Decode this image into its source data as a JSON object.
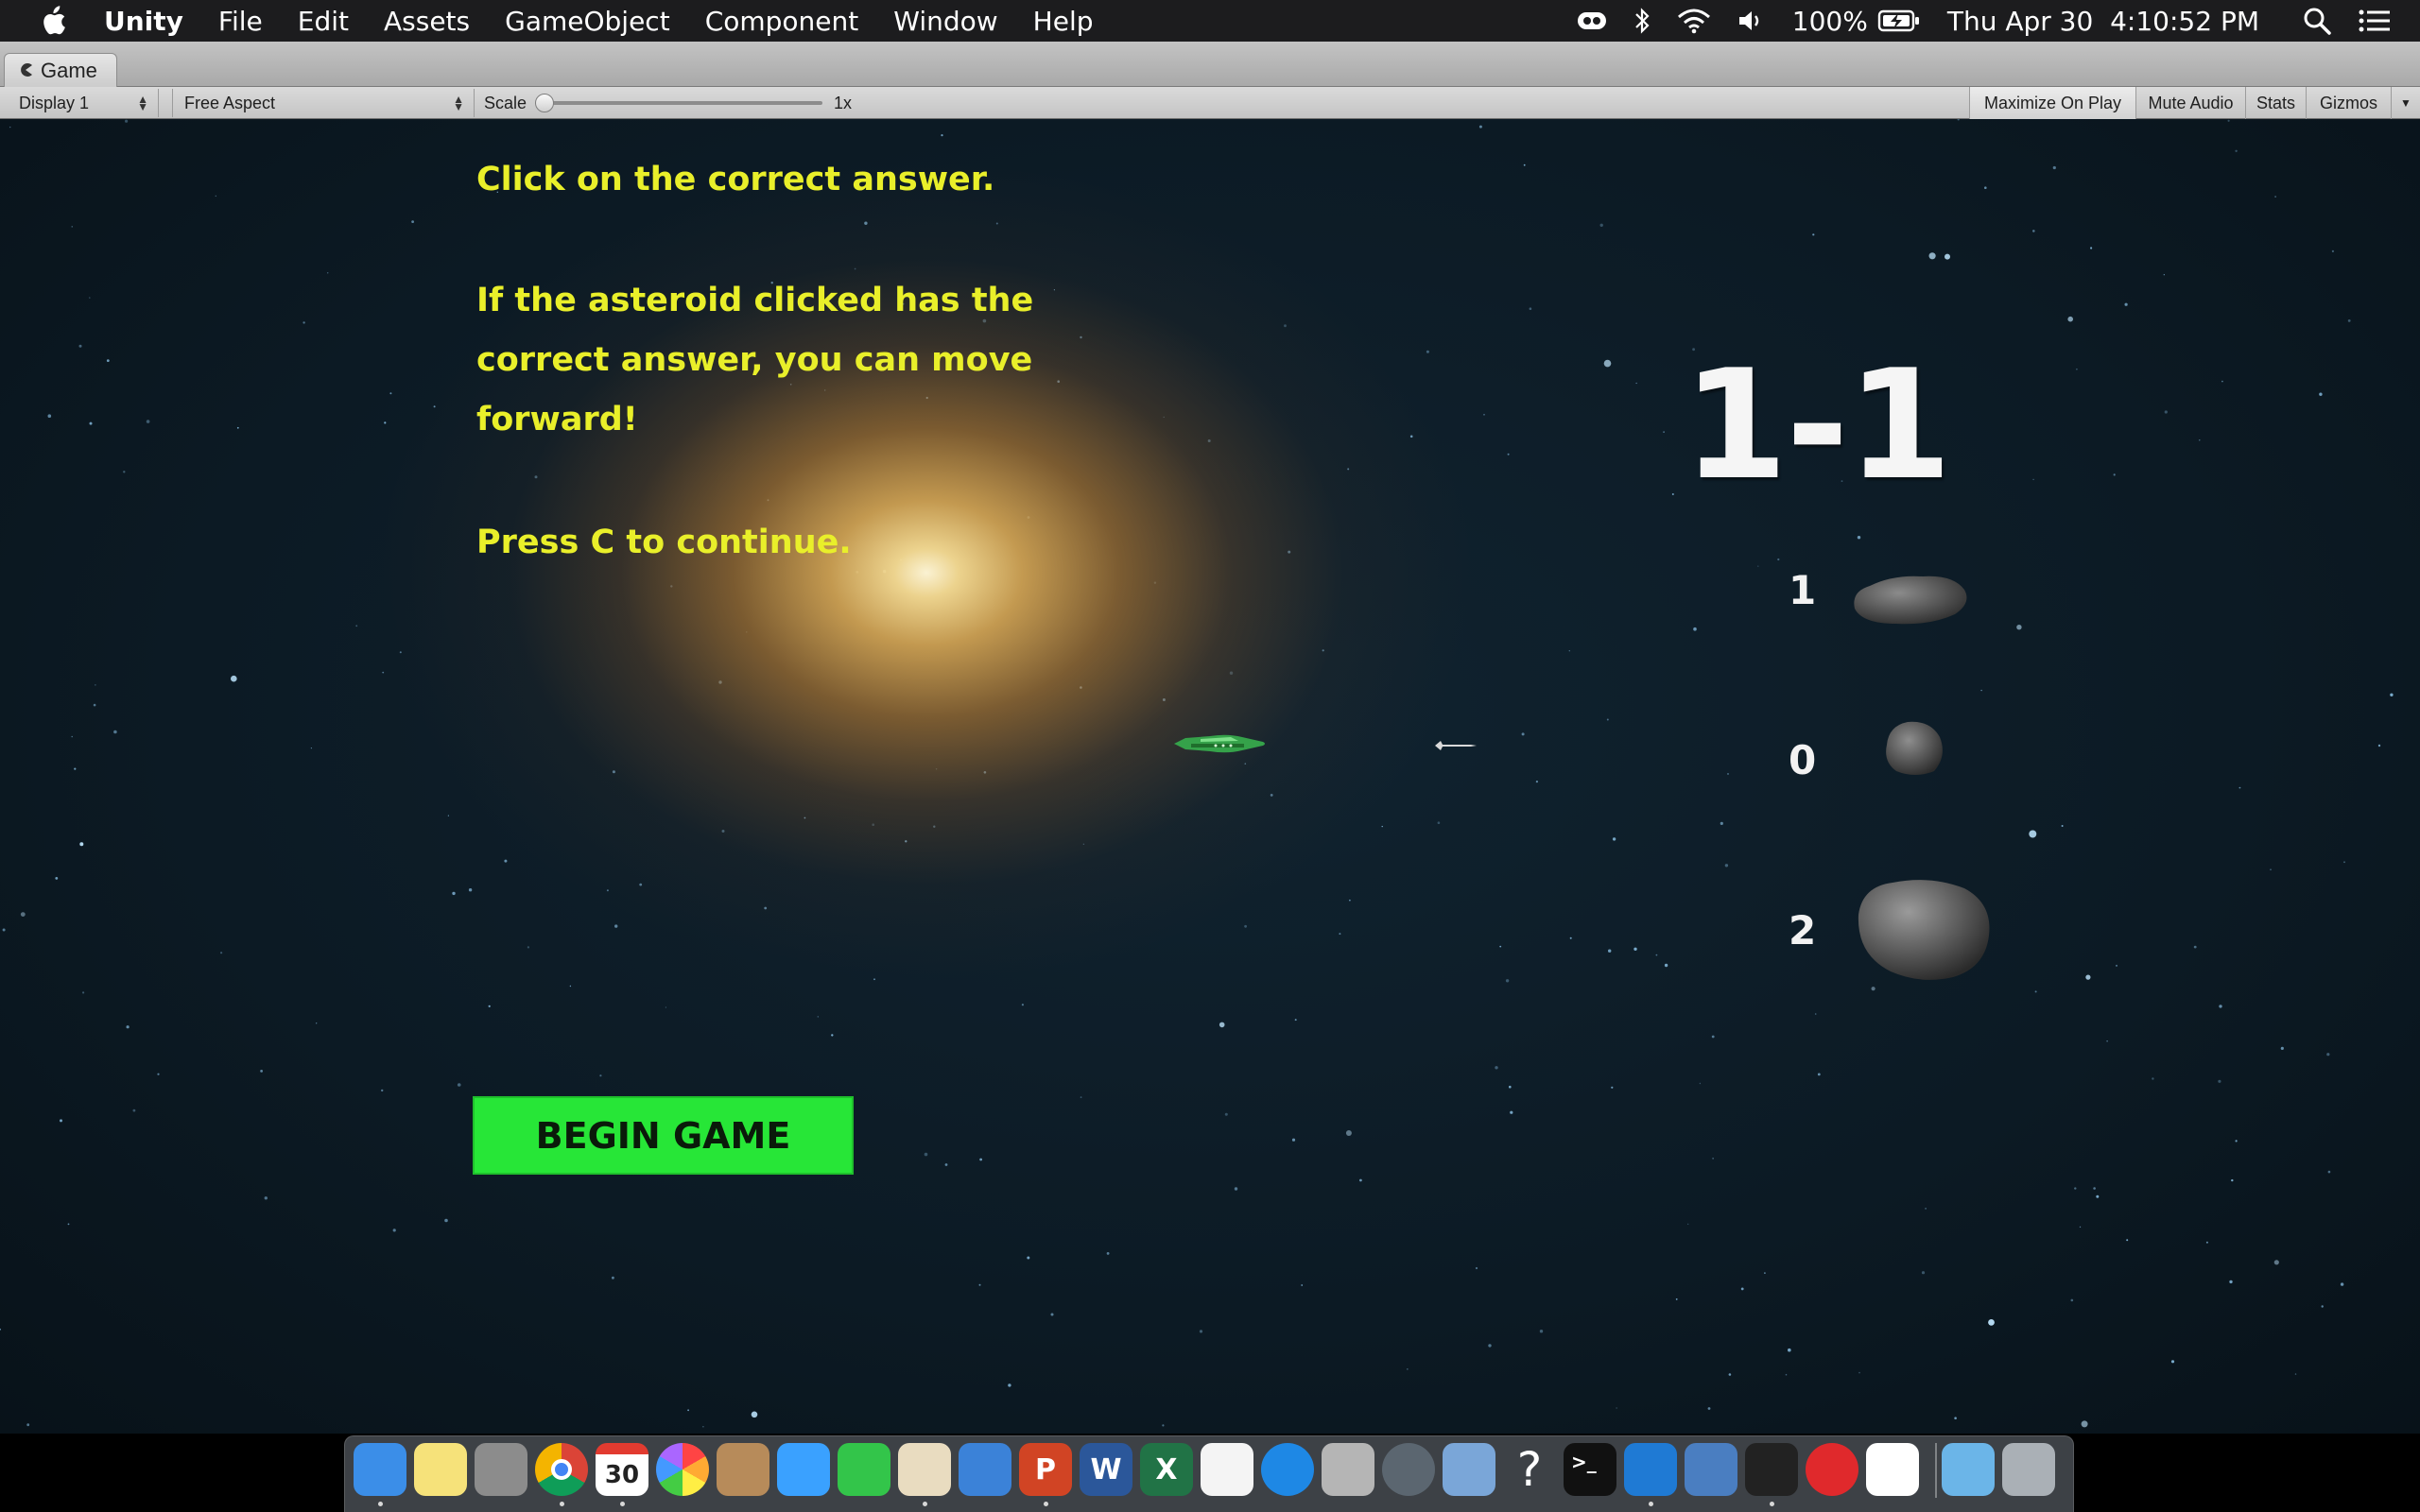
{
  "menubar": {
    "apple_icon": "apple-logo-icon",
    "app_name": "Unity",
    "menus": [
      "File",
      "Edit",
      "Assets",
      "GameObject",
      "Component",
      "Window",
      "Help"
    ],
    "battery_percent": "100%",
    "datetime": "Thu Apr 30  4:10:52 PM",
    "status_icons": [
      "creative-cloud-icon",
      "bluetooth-icon",
      "wifi-icon",
      "volume-icon",
      "battery-charging-icon",
      "spotlight-search-icon",
      "control-center-icon"
    ]
  },
  "window": {
    "tab_label": "Game",
    "display_select": "Display 1",
    "aspect_select": "Free Aspect",
    "scale_label": "Scale",
    "scale_value": "1x",
    "scale_level": 0,
    "buttons": {
      "maximize": "Maximize On Play",
      "mute": "Mute Audio",
      "stats": "Stats",
      "gizmos": "Gizmos"
    }
  },
  "game": {
    "instructions": {
      "line1": "Click on the correct answer.",
      "line2": "If the asteroid clicked has the",
      "line3": "correct answer, you can move",
      "line4": "forward!",
      "line5": "Press C to continue."
    },
    "level": "1-1",
    "answers": [
      "1",
      "0",
      "2"
    ],
    "begin_button": "BEGIN GAME"
  },
  "colors": {
    "instruction_text": "#e9ef2a",
    "begin_button": "#27e637",
    "space_bg": "#0c1a24"
  },
  "dock": {
    "apps": [
      {
        "name": "finder-icon",
        "label": "",
        "color": "#3b8ee8",
        "running": true
      },
      {
        "name": "notes-icon",
        "label": "",
        "color": "#f6e27a",
        "running": false
      },
      {
        "name": "calculator-icon",
        "label": "",
        "color": "#8c8c8c",
        "running": false
      },
      {
        "name": "chrome-icon",
        "label": "",
        "color": "#e8e8e8",
        "running": true
      },
      {
        "name": "calendar-icon",
        "label": "30",
        "color": "#ffffff",
        "running": true
      },
      {
        "name": "photos-icon",
        "label": "",
        "color": "#f4f4f4",
        "running": false
      },
      {
        "name": "contacts-icon",
        "label": "",
        "color": "#b78b5a",
        "running": false
      },
      {
        "name": "messages-icon",
        "label": "",
        "color": "#3aa1ff",
        "running": false
      },
      {
        "name": "facetime-icon",
        "label": "",
        "color": "#33c54a",
        "running": false
      },
      {
        "name": "textedit-icon",
        "label": "",
        "color": "#e9dcc0",
        "running": true
      },
      {
        "name": "keynote-icon",
        "label": "",
        "color": "#3b82d8",
        "running": false
      },
      {
        "name": "powerpoint-icon",
        "label": "P",
        "color": "#d14424",
        "running": true
      },
      {
        "name": "word-icon",
        "label": "W",
        "color": "#2b579a",
        "running": false
      },
      {
        "name": "excel-icon",
        "label": "X",
        "color": "#217346",
        "running": false
      },
      {
        "name": "itunes-icon",
        "label": "",
        "color": "#f4f4f4",
        "running": false
      },
      {
        "name": "app-store-icon",
        "label": "",
        "color": "#1e88e5",
        "running": false
      },
      {
        "name": "dvd-player-icon",
        "label": "",
        "color": "#b5b5b5",
        "running": false
      },
      {
        "name": "quicktime-icon",
        "label": "",
        "color": "#5b6670",
        "running": false
      },
      {
        "name": "preview-icon",
        "label": "",
        "color": "#7aa6d8",
        "running": false
      },
      {
        "name": "help-icon",
        "label": "?",
        "color": "transparent",
        "running": false
      },
      {
        "name": "terminal-icon",
        "label": ">_",
        "color": "#111111",
        "running": false
      },
      {
        "name": "vscode-icon",
        "label": "",
        "color": "#1f7ad4",
        "running": true
      },
      {
        "name": "virtualbox-icon",
        "label": "",
        "color": "#4a7ec1",
        "running": false
      },
      {
        "name": "unity-icon",
        "label": "",
        "color": "#222222",
        "running": true
      },
      {
        "name": "creative-cloud-icon",
        "label": "",
        "color": "#e0292c",
        "running": false
      },
      {
        "name": "slack-icon",
        "label": "",
        "color": "#ffffff",
        "running": false
      },
      {
        "name": "downloads-folder-icon",
        "label": "",
        "color": "#6bb5e8",
        "running": false
      },
      {
        "name": "trash-icon",
        "label": "",
        "color": "#aab0b6",
        "running": false
      }
    ]
  }
}
